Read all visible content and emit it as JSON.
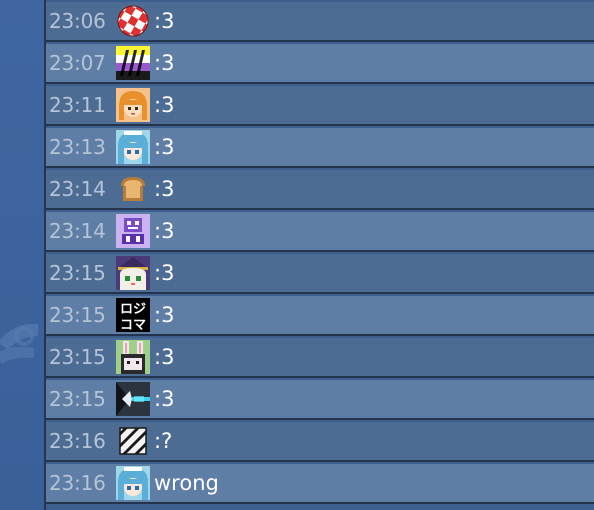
{
  "messages": [
    {
      "time": "23:06",
      "avatar": "checkered-ball-avatar",
      "text": ":3"
    },
    {
      "time": "23:07",
      "avatar": "striped-flag-avatar",
      "text": ":3"
    },
    {
      "time": "23:11",
      "avatar": "blonde-girl-avatar",
      "text": ":3"
    },
    {
      "time": "23:13",
      "avatar": "blue-hair-girl-avatar",
      "text": ":3"
    },
    {
      "time": "23:14",
      "avatar": "bread-avatar",
      "text": ":3"
    },
    {
      "time": "23:14",
      "avatar": "purple-robot-avatar",
      "text": ":3"
    },
    {
      "time": "23:15",
      "avatar": "witch-cat-avatar",
      "text": ":3"
    },
    {
      "time": "23:15",
      "avatar": "logic-kanji-avatar",
      "text": ":3"
    },
    {
      "time": "23:15",
      "avatar": "bunny-avatar",
      "text": ":3"
    },
    {
      "time": "23:15",
      "avatar": "cyan-beam-avatar",
      "text": ":3"
    },
    {
      "time": "23:16",
      "avatar": "diagonal-stripes-avatar",
      "text": ":?"
    },
    {
      "time": "23:16",
      "avatar": "blue-hair-girl-avatar",
      "text": "wrong"
    }
  ],
  "avatar_kanji": [
    "ロジ",
    "コマ"
  ],
  "colors": {
    "row_dark": "#4d6c94",
    "row_light": "#5f7ea6",
    "timestamp": "#b4c4d6",
    "message_text": "#ffffff",
    "sidebar": "#3f66a0"
  }
}
